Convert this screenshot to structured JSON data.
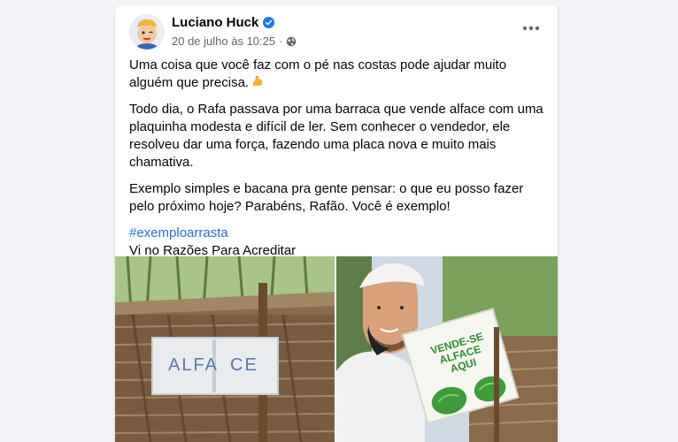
{
  "post": {
    "author": "Luciano Huck",
    "timestamp": "20 de julho às 10:25",
    "separator": "·",
    "paragraphs": [
      "Uma coisa que você faz com o pé nas costas pode ajudar muito alguém que precisa.",
      "Todo dia, o Rafa passava por uma barraca que vende alface com uma plaquinha modesta e difícil de ler. Sem conhecer o vendedor, ele resolveu dar uma força, fazendo uma placa nova e muito mais chamativa.",
      "Exemplo simples e bacana pra gente pensar: o que eu posso fazer pelo próximo hoje? Parabéns, Rafão. Você é exemplo!"
    ],
    "hashtag": "#exemploarrasta",
    "source": "Vi no Razões Para Acreditar"
  },
  "photos": {
    "left_sign": [
      "ALFA",
      "CE"
    ],
    "right_sign": [
      "VENDE-SE",
      "ALFACE",
      "AQUI"
    ]
  },
  "colors": {
    "background": "#f0f2f5",
    "card": "#ffffff",
    "link": "#216fdb",
    "meta_text": "#65676b",
    "verified": "#1877f2"
  },
  "icons": {
    "verified": "verified-badge-icon",
    "privacy": "globe-icon",
    "menu": "more-options-icon",
    "emoji": "flexed-biceps-icon"
  }
}
